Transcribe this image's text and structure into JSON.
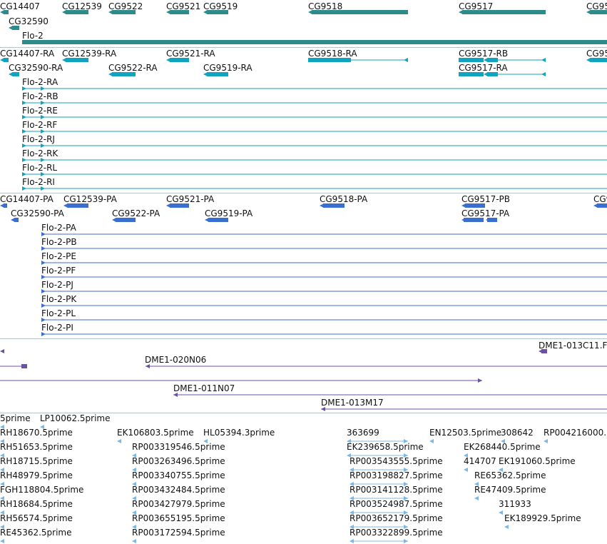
{
  "colors": {
    "gene": "#2e8b8b",
    "transcript": "#12a3bf",
    "protein": "#3a6fd0",
    "clone": "#6b50a8",
    "est": "#7cb8e4",
    "separator": "#b8c4c8"
  },
  "tracks": {
    "genes": {
      "features": [
        {
          "label": "CG14407",
          "strand": "-"
        },
        {
          "label": "CG12539",
          "strand": "-"
        },
        {
          "label": "CG9522",
          "strand": "-"
        },
        {
          "label": "CG9521",
          "strand": "-"
        },
        {
          "label": "CG9519",
          "strand": "-"
        },
        {
          "label": "CG9518",
          "strand": "-"
        },
        {
          "label": "CG9517",
          "strand": "-"
        },
        {
          "label": "CG95",
          "strand": "-"
        },
        {
          "label": "CG32590",
          "strand": "-"
        },
        {
          "label": "Flo-2",
          "strand": "+"
        }
      ]
    },
    "transcripts": {
      "features": [
        {
          "label": "CG14407-RA",
          "strand": "-"
        },
        {
          "label": "CG12539-RA",
          "strand": "-"
        },
        {
          "label": "CG9521-RA",
          "strand": "-"
        },
        {
          "label": "CG9518-RA",
          "strand": "-"
        },
        {
          "label": "CG9517-RB",
          "strand": "-"
        },
        {
          "label": "CG95",
          "strand": "-"
        },
        {
          "label": "CG32590-RA",
          "strand": "-"
        },
        {
          "label": "CG9522-RA",
          "strand": "-"
        },
        {
          "label": "CG9519-RA",
          "strand": "-"
        },
        {
          "label": "CG9517-RA",
          "strand": "-"
        },
        {
          "label": "Flo-2-RA",
          "strand": "+"
        },
        {
          "label": "Flo-2-RB",
          "strand": "+"
        },
        {
          "label": "Flo-2-RE",
          "strand": "+"
        },
        {
          "label": "Flo-2-RF",
          "strand": "+"
        },
        {
          "label": "Flo-2-RJ",
          "strand": "+"
        },
        {
          "label": "Flo-2-RK",
          "strand": "+"
        },
        {
          "label": "Flo-2-RL",
          "strand": "+"
        },
        {
          "label": "Flo-2-RI",
          "strand": "+"
        }
      ]
    },
    "proteins": {
      "features": [
        {
          "label": "CG14407-PA",
          "strand": "-"
        },
        {
          "label": "CG12539-PA",
          "strand": "-"
        },
        {
          "label": "CG9521-PA",
          "strand": "-"
        },
        {
          "label": "CG9518-PA",
          "strand": "-"
        },
        {
          "label": "CG9517-PB",
          "strand": "-"
        },
        {
          "label": "CG9",
          "strand": "-"
        },
        {
          "label": "CG32590-PA",
          "strand": "-"
        },
        {
          "label": "CG9522-PA",
          "strand": "-"
        },
        {
          "label": "CG9519-PA",
          "strand": "-"
        },
        {
          "label": "CG9517-PA",
          "strand": "-"
        },
        {
          "label": "Flo-2-PA",
          "strand": "+"
        },
        {
          "label": "Flo-2-PB",
          "strand": "+"
        },
        {
          "label": "Flo-2-PE",
          "strand": "+"
        },
        {
          "label": "Flo-2-PF",
          "strand": "+"
        },
        {
          "label": "Flo-2-PJ",
          "strand": "+"
        },
        {
          "label": "Flo-2-PK",
          "strand": "+"
        },
        {
          "label": "Flo-2-PL",
          "strand": "+"
        },
        {
          "label": "Flo-2-PI",
          "strand": "+"
        }
      ]
    },
    "clones": {
      "features": [
        {
          "label": "DME1-013C11.F",
          "strand": "-"
        },
        {
          "label": "DME1-020N06",
          "strand": "-"
        },
        {
          "label": "DME1-011N07",
          "strand": "-"
        },
        {
          "label": "DME1-013M17",
          "strand": "-"
        }
      ]
    },
    "ests": {
      "features": [
        {
          "label": "5prime"
        },
        {
          "label": "LP10062.5prime"
        },
        {
          "label": "RH18670.5prime"
        },
        {
          "label": "EK106803.5prime"
        },
        {
          "label": "HL05394.3prime"
        },
        {
          "label": "363699"
        },
        {
          "label": "EN12503.5prime"
        },
        {
          "label": "308642"
        },
        {
          "label": "RP004216000."
        },
        {
          "label": "RH51653.5prime"
        },
        {
          "label": "RP003319546.5prime"
        },
        {
          "label": "EK239658.5prime"
        },
        {
          "label": "EK268440.5prime"
        },
        {
          "label": "RH18715.5prime"
        },
        {
          "label": "RP003263496.5prime"
        },
        {
          "label": "RP003543555.5prime"
        },
        {
          "label": "414707"
        },
        {
          "label": "EK191060.5prime"
        },
        {
          "label": "RH48979.5prime"
        },
        {
          "label": "RP003340755.5prime"
        },
        {
          "label": "RP003198827.5prime"
        },
        {
          "label": "RE65362.5prime"
        },
        {
          "label": "FGH118804.5prime"
        },
        {
          "label": "RP003432484.5prime"
        },
        {
          "label": "RP003141128.5prime"
        },
        {
          "label": "RE47409.5prime"
        },
        {
          "label": "RH18684.5prime"
        },
        {
          "label": "RP003427979.5prime"
        },
        {
          "label": "RP003524987.5prime"
        },
        {
          "label": "311933"
        },
        {
          "label": "RH56574.5prime"
        },
        {
          "label": "RP003655195.5prime"
        },
        {
          "label": "RP003652179.5prime"
        },
        {
          "label": "EK189929.5prime"
        },
        {
          "label": "RE45362.5prime"
        },
        {
          "label": "RP003172594.5prime"
        },
        {
          "label": "RP003322899.5prime"
        }
      ]
    }
  }
}
